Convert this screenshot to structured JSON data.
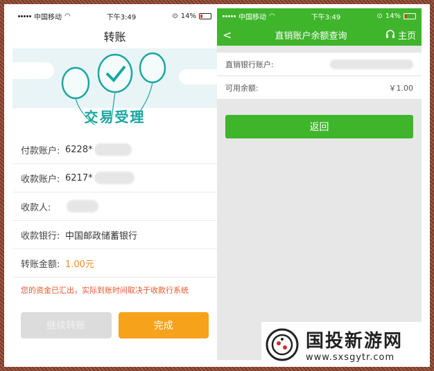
{
  "left": {
    "status": {
      "carrier": "中国移动",
      "time": "下午3:49",
      "battery": "14%"
    },
    "title": "转账",
    "banner_title": "交易受理",
    "rows": [
      {
        "label": "付款账户:",
        "value": "6228*"
      },
      {
        "label": "收款账户:",
        "value": "6217*"
      },
      {
        "label": "收款人:",
        "value": ""
      },
      {
        "label": "收款银行:",
        "value": "中国邮政储蓄银行"
      },
      {
        "label": "转账金额:",
        "value": "1.00元"
      }
    ],
    "notice": "您的资金已汇出，实际到账时间取决于收款行系统",
    "btn_continue": "继续转账",
    "btn_done": "完成"
  },
  "right": {
    "status": {
      "carrier": "中国移动",
      "time": "下午3:49",
      "battery": "14%"
    },
    "back": "<",
    "title": "直销账户余额查询",
    "home": "主页",
    "account_label": "直销银行账户:",
    "balance_label": "可用余额:",
    "balance_value": "￥1.00",
    "back_button": "返回"
  },
  "watermark": {
    "title": "国投新游网",
    "url": "www.sxsgytr.com"
  },
  "colors": {
    "green": "#3fb52c",
    "orange": "#f6a21b",
    "teal": "#19a7a0",
    "notice": "#e8572e"
  }
}
